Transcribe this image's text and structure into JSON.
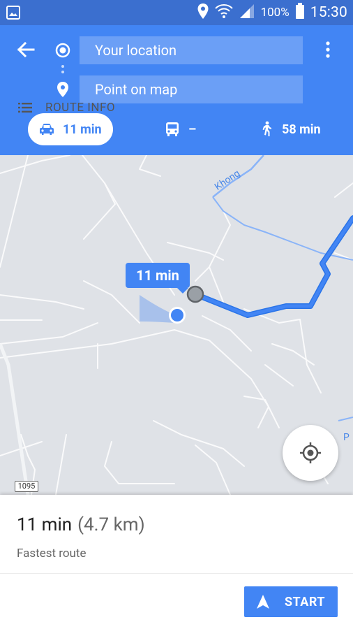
{
  "status_bar": {
    "battery_percent": "100%",
    "time": "15:30",
    "icons": [
      "image-icon",
      "location-icon",
      "wifi-icon",
      "signal-icon",
      "battery-icon"
    ]
  },
  "header": {
    "origin_placeholder": "Your location",
    "destination_placeholder": "Point on map",
    "modes": [
      {
        "name": "drive",
        "icon": "car-icon",
        "label": "11 min",
        "selected": true
      },
      {
        "name": "transit",
        "icon": "bus-icon",
        "label": "–",
        "selected": false
      },
      {
        "name": "walk",
        "icon": "walk-icon",
        "label": "58 min",
        "selected": false
      }
    ]
  },
  "map": {
    "route_label": "11 min",
    "river_label": "Khong",
    "edge_label": "P",
    "road_shield": "1095"
  },
  "summary": {
    "duration": "11 min",
    "distance": "(4.7 km)",
    "description": "Fastest route"
  },
  "actions": {
    "route_info_label": "ROUTE INFO",
    "start_label": "START"
  },
  "colors": {
    "accent": "#4285f4",
    "status_bar": "#3b6fcf",
    "map_bg": "#dfe2e7"
  }
}
